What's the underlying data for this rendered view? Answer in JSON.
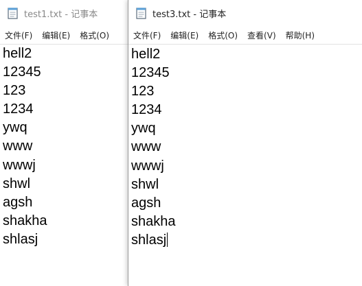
{
  "windows": {
    "back": {
      "title": "test1.txt - 记事本",
      "menu": [
        "文件(F)",
        "编辑(E)",
        "格式(O)"
      ],
      "lines": [
        "hell2",
        "12345",
        "123",
        "1234",
        "ywq",
        "www",
        "wwwj",
        "shwl",
        "agsh",
        "shakha",
        "shlasj"
      ]
    },
    "front": {
      "title": "test3.txt - 记事本",
      "menu": [
        "文件(F)",
        "编辑(E)",
        "格式(O)",
        "查看(V)",
        "帮助(H)"
      ],
      "lines": [
        "hell2",
        "12345",
        "123",
        "1234",
        "ywq",
        "www",
        "wwwj",
        "shwl",
        "agsh",
        "shakha",
        "shlasj"
      ]
    }
  },
  "icons": {
    "title_icon": "notepad-icon"
  },
  "colors": {
    "window_bg": "#ffffff",
    "text": "#000000",
    "inactive_title": "#888888"
  }
}
